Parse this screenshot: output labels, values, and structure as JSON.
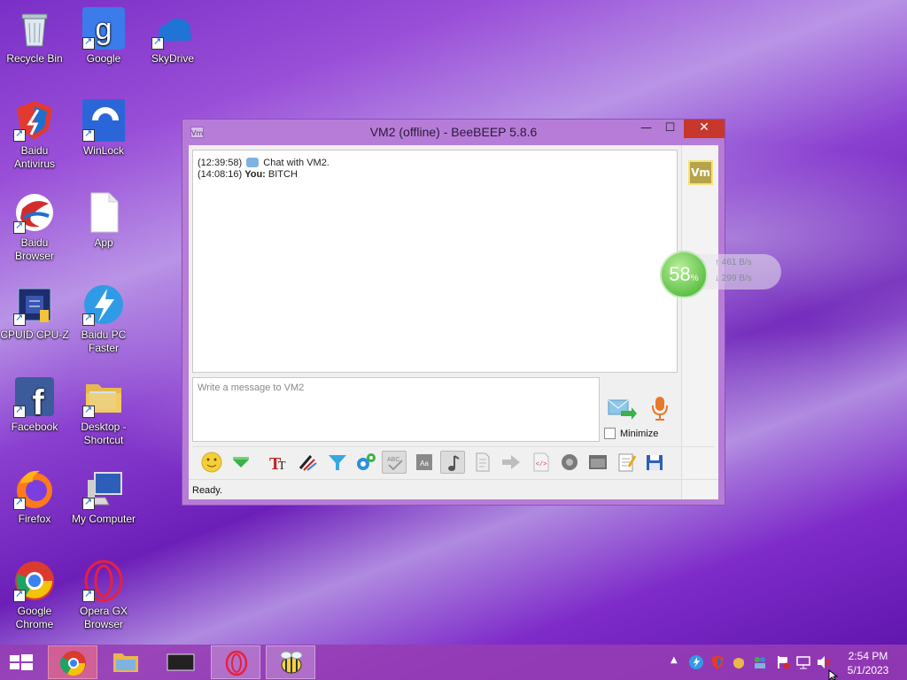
{
  "desktop": {
    "icons": [
      {
        "label": "Recycle Bin"
      },
      {
        "label": "Google"
      },
      {
        "label": "SkyDrive"
      },
      {
        "label": "Baidu Antivirus"
      },
      {
        "label": "WinLock"
      },
      {
        "label": "Baidu Browser"
      },
      {
        "label": "App"
      },
      {
        "label": "CPUID CPU-Z"
      },
      {
        "label": "Baidu PC Faster"
      },
      {
        "label": "Facebook"
      },
      {
        "label": "Desktop - Shortcut"
      },
      {
        "label": "Firefox"
      },
      {
        "label": "My Computer"
      },
      {
        "label": "Google Chrome"
      },
      {
        "label": "Opera GX Browser"
      }
    ]
  },
  "window": {
    "icon_text": "Vm",
    "title": "VM2 (offline) - BeeBEEP 5.8.6",
    "min_glyph": "—",
    "max_glyph": "☐",
    "close_glyph": "✕",
    "chat": {
      "line1_time": "(12:39:58)",
      "line1_text": "Chat with VM2.",
      "line2_time": "(14:08:16)",
      "line2_sender": "You:",
      "line2_text": "BITCH"
    },
    "user_avatar": "Vm",
    "input_placeholder": "Write a message to VM2",
    "minimize_label": "Minimize",
    "status": "Ready."
  },
  "speed_widget": {
    "percent": "58",
    "percent_unit": "%",
    "upload": "461 B/s",
    "download": "299 B/s"
  },
  "taskbar": {
    "time": "2:54 PM",
    "date": "5/1/2023"
  },
  "colors": {
    "close_button": "#c7372c",
    "window_frame": "#b77cd8",
    "taskbar": "#963cb4"
  }
}
